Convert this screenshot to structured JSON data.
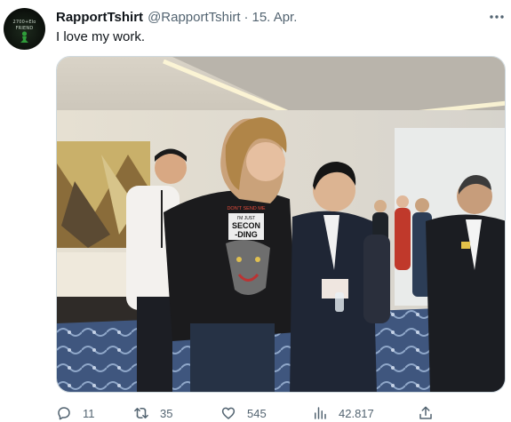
{
  "tweet": {
    "author_name": "RapportTshirt",
    "handle": "@RapportTshirt",
    "separator": "·",
    "date": "15. Apr.",
    "text": "I love my work.",
    "avatar": {
      "line1": "2700+Elo",
      "line2": "FRIEND",
      "icon": "chess-pawn-icon"
    },
    "media_shirt_text": {
      "line1": "DON'T SEND ME",
      "line2": "I'M JUST",
      "line3": "SECON",
      "line4": "-DING"
    }
  },
  "actions": {
    "replies": "11",
    "retweets": "35",
    "likes": "545",
    "views": "42.817"
  },
  "colors": {
    "text": "#0f1419",
    "secondary": "#536471",
    "border": "#cfd9de"
  },
  "icons": [
    "more-icon",
    "reply-icon",
    "retweet-icon",
    "like-icon",
    "views-icon",
    "share-icon"
  ]
}
